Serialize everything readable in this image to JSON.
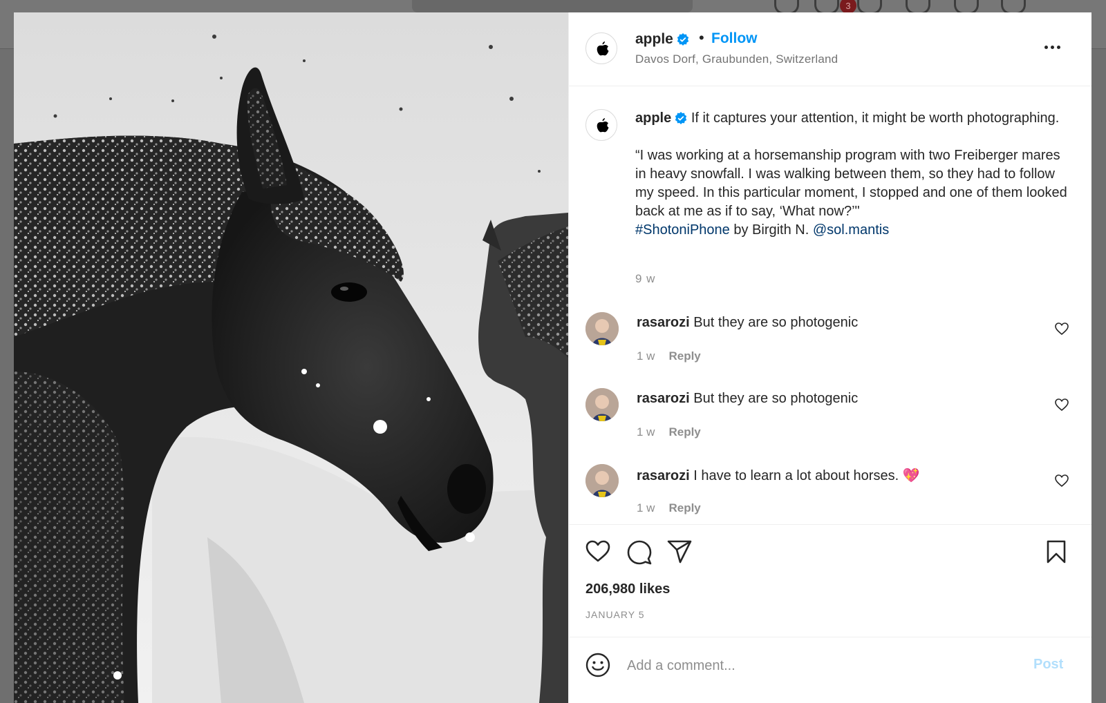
{
  "post": {
    "username": "apple",
    "follow_label": "Follow",
    "dot": "•",
    "location": "Davos Dorf, Graubunden, Switzerland",
    "notification_count": "3"
  },
  "caption": {
    "username": "apple",
    "line1": "If it captures your attention, it might be worth photographing.",
    "quote": "“I was working at a horsemanship program with two Freiberger mares in heavy snowfall. I was walking between them, so they had to follow my speed. In this particular moment, I stopped and one of them looked back at me as if to say, ‘What now?’\"",
    "hashtag": "#ShotoniPhone",
    "by": "by Birgith N.",
    "mention": "@sol.mantis",
    "time": "9 w"
  },
  "comments": [
    {
      "username": "rasarozi",
      "text": "But they are so photogenic",
      "time": "1 w",
      "reply": "Reply"
    },
    {
      "username": "rasarozi",
      "text": "But they are so photogenic",
      "time": "1 w",
      "reply": "Reply"
    },
    {
      "username": "rasarozi",
      "text": "I have to learn a lot about horses. 💖",
      "time": "1 w",
      "reply": "Reply"
    }
  ],
  "stats": {
    "likes": "206,980 likes",
    "date": "JANUARY 5"
  },
  "composer": {
    "placeholder": "Add a comment...",
    "post_label": "Post"
  },
  "icons": {
    "like": "heart-icon",
    "comment": "comment-bubble-icon",
    "share": "paper-plane-icon",
    "save": "bookmark-icon",
    "emoji": "smiley-icon",
    "more": "more-options-icon",
    "verified": "verified-badge-icon"
  },
  "colors": {
    "follow": "#0095f6",
    "verified": "#0095f6",
    "link": "#00376b",
    "post_disabled": "#b2dffc",
    "secondary_text": "#8e8e8e"
  }
}
